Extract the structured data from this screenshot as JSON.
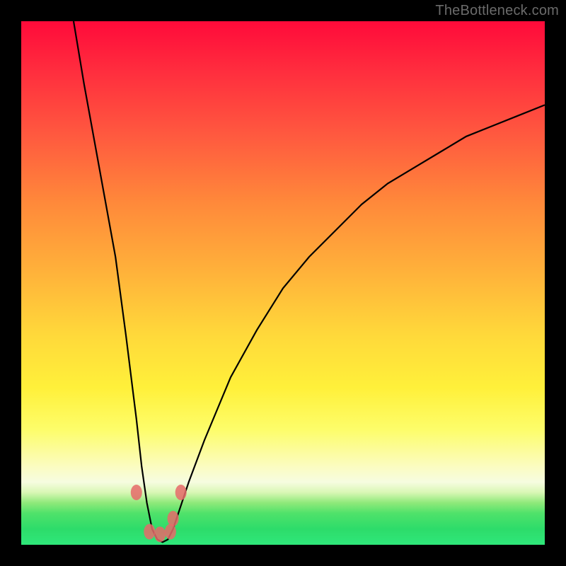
{
  "watermark": "TheBottleneck.com",
  "colors": {
    "curve_stroke": "#000000",
    "marker_fill": "#e66a6a",
    "background": "#000000"
  },
  "chart_data": {
    "type": "line",
    "title": "",
    "xlabel": "",
    "ylabel": "",
    "xlim": [
      0,
      100
    ],
    "ylim": [
      0,
      100
    ],
    "grid": false,
    "series": [
      {
        "name": "bottleneck-curve",
        "x": [
          10,
          12,
          14,
          16,
          18,
          20,
          21,
          22,
          23,
          24,
          25,
          26,
          27,
          28,
          29,
          30,
          32,
          35,
          40,
          45,
          50,
          55,
          60,
          65,
          70,
          75,
          80,
          85,
          90,
          95,
          100
        ],
        "y": [
          100,
          88,
          77,
          66,
          55,
          40,
          32,
          24,
          15,
          8,
          3,
          1,
          0.5,
          1,
          3,
          6,
          12,
          20,
          32,
          41,
          49,
          55,
          60,
          65,
          69,
          72,
          75,
          78,
          80,
          82,
          84
        ]
      }
    ],
    "markers": [
      {
        "x": 22.0,
        "y": 10.0
      },
      {
        "x": 24.5,
        "y": 2.5
      },
      {
        "x": 26.5,
        "y": 2.0
      },
      {
        "x": 28.5,
        "y": 2.5
      },
      {
        "x": 29.0,
        "y": 5.0
      },
      {
        "x": 30.5,
        "y": 10.0
      }
    ]
  }
}
